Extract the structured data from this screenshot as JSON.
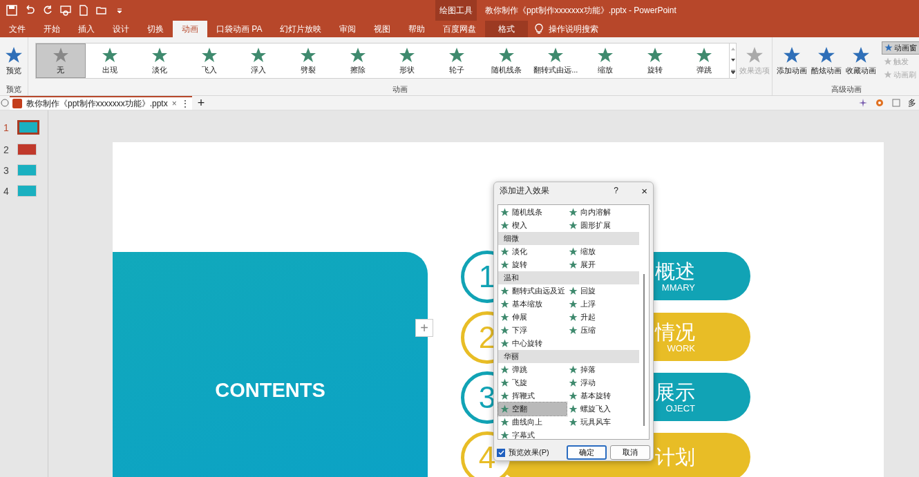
{
  "title_bar": {
    "context_label": "绘图工具",
    "title": "教你制作《ppt制作xxxxxxx功能》.pptx  -  PowerPoint"
  },
  "ribbon_tabs": [
    {
      "label": "文件",
      "selected": false,
      "kind": "normal"
    },
    {
      "label": "开始",
      "selected": false,
      "kind": "normal"
    },
    {
      "label": "插入",
      "selected": false,
      "kind": "normal"
    },
    {
      "label": "设计",
      "selected": false,
      "kind": "normal"
    },
    {
      "label": "切换",
      "selected": false,
      "kind": "normal"
    },
    {
      "label": "动画",
      "selected": true,
      "kind": "normal"
    },
    {
      "label": "口袋动画 PA",
      "selected": false,
      "kind": "normal"
    },
    {
      "label": "幻灯片放映",
      "selected": false,
      "kind": "normal"
    },
    {
      "label": "审阅",
      "selected": false,
      "kind": "normal"
    },
    {
      "label": "视图",
      "selected": false,
      "kind": "normal"
    },
    {
      "label": "帮助",
      "selected": false,
      "kind": "normal"
    },
    {
      "label": "百度网盘",
      "selected": false,
      "kind": "normal"
    },
    {
      "label": "格式",
      "selected": false,
      "kind": "context"
    }
  ],
  "tell_me": "操作说明搜索",
  "ribbon": {
    "preview": {
      "label": "预览",
      "group": "预览"
    },
    "gallery": [
      {
        "label": "无",
        "selected": true
      },
      {
        "label": "出现",
        "selected": false
      },
      {
        "label": "淡化",
        "selected": false
      },
      {
        "label": "飞入",
        "selected": false
      },
      {
        "label": "浮入",
        "selected": false
      },
      {
        "label": "劈裂",
        "selected": false
      },
      {
        "label": "擦除",
        "selected": false
      },
      {
        "label": "形状",
        "selected": false
      },
      {
        "label": "轮子",
        "selected": false
      },
      {
        "label": "随机线条",
        "selected": false
      },
      {
        "label": "翻转式由远...",
        "selected": false
      },
      {
        "label": "缩放",
        "selected": false
      },
      {
        "label": "旋转",
        "selected": false
      },
      {
        "label": "弹跳",
        "selected": false
      }
    ],
    "effect_options": {
      "label": "效果选项",
      "disabled": true
    },
    "animation_group": "动画",
    "advanced": [
      {
        "label": "添加动画"
      },
      {
        "label": "酷炫动画"
      },
      {
        "label": "收藏动画"
      }
    ],
    "advanced_small": [
      {
        "label": "动画窗",
        "disabled": false,
        "selected": true
      },
      {
        "label": "触发",
        "disabled": true,
        "selected": false
      },
      {
        "label": "动画刷",
        "disabled": true,
        "selected": false
      }
    ],
    "advanced_group": "高级动画"
  },
  "document_tab": {
    "title": "教你制作《ppt制作xxxxxxx功能》.pptx",
    "close": "×",
    "more": "⋮",
    "add": "+",
    "right_text": "多"
  },
  "thumbnails": [
    {
      "number": "1",
      "selected": true,
      "color": "#1ab0c0"
    },
    {
      "number": "2",
      "selected": false,
      "color": "#c0392b"
    },
    {
      "number": "3",
      "selected": false,
      "color": "#1ab0c0"
    },
    {
      "number": "4",
      "selected": false,
      "color": "#1ab0c0"
    }
  ],
  "slide": {
    "heading": "CONTENTS",
    "add_button": "+",
    "items": [
      {
        "number": "1",
        "color": "#11a3b5",
        "title": "概述",
        "subtitle": "MMARY"
      },
      {
        "number": "2",
        "color": "#e8bd26",
        "title": "情况",
        "subtitle": "WORK"
      },
      {
        "number": "3",
        "color": "#11a3b5",
        "title": "展示",
        "subtitle": "OJECT"
      },
      {
        "number": "4",
        "color": "#e8bd26",
        "title": "计划"
      }
    ]
  },
  "dialog": {
    "title": "添加进入效果",
    "help": "?",
    "close": "×",
    "sections": [
      {
        "items": [
          {
            "label": "随机线条",
            "selected": false
          },
          {
            "label": "向内溶解",
            "selected": false
          },
          {
            "label": "楔入",
            "selected": false
          },
          {
            "label": "圆形扩展",
            "selected": false
          }
        ]
      },
      {
        "header": "细微",
        "items": [
          {
            "label": "淡化",
            "selected": false
          },
          {
            "label": "缩放",
            "selected": false
          },
          {
            "label": "旋转",
            "selected": false
          },
          {
            "label": "展开",
            "selected": false
          }
        ]
      },
      {
        "header": "温和",
        "items": [
          {
            "label": "翻转式由远及近",
            "selected": false
          },
          {
            "label": "回旋",
            "selected": false
          },
          {
            "label": "基本缩放",
            "selected": false
          },
          {
            "label": "上浮",
            "selected": false
          },
          {
            "label": "伸展",
            "selected": false
          },
          {
            "label": "升起",
            "selected": false
          },
          {
            "label": "下浮",
            "selected": false
          },
          {
            "label": "压缩",
            "selected": false
          },
          {
            "label": "中心旋转",
            "selected": false
          }
        ]
      },
      {
        "header": "华丽",
        "items": [
          {
            "label": "弹跳",
            "selected": false
          },
          {
            "label": "掉落",
            "selected": false
          },
          {
            "label": "飞旋",
            "selected": false
          },
          {
            "label": "浮动",
            "selected": false
          },
          {
            "label": "挥鞭式",
            "selected": false
          },
          {
            "label": "基本旋转",
            "selected": false
          },
          {
            "label": "空翻",
            "selected": true
          },
          {
            "label": "螺旋飞入",
            "selected": false
          },
          {
            "label": "曲线向上",
            "selected": false
          },
          {
            "label": "玩具风车",
            "selected": false
          },
          {
            "label": "字幕式",
            "selected": false
          }
        ]
      }
    ],
    "preview_checkbox": {
      "label": "预览效果(P)",
      "checked": true
    },
    "ok": "确定",
    "cancel": "取消"
  }
}
